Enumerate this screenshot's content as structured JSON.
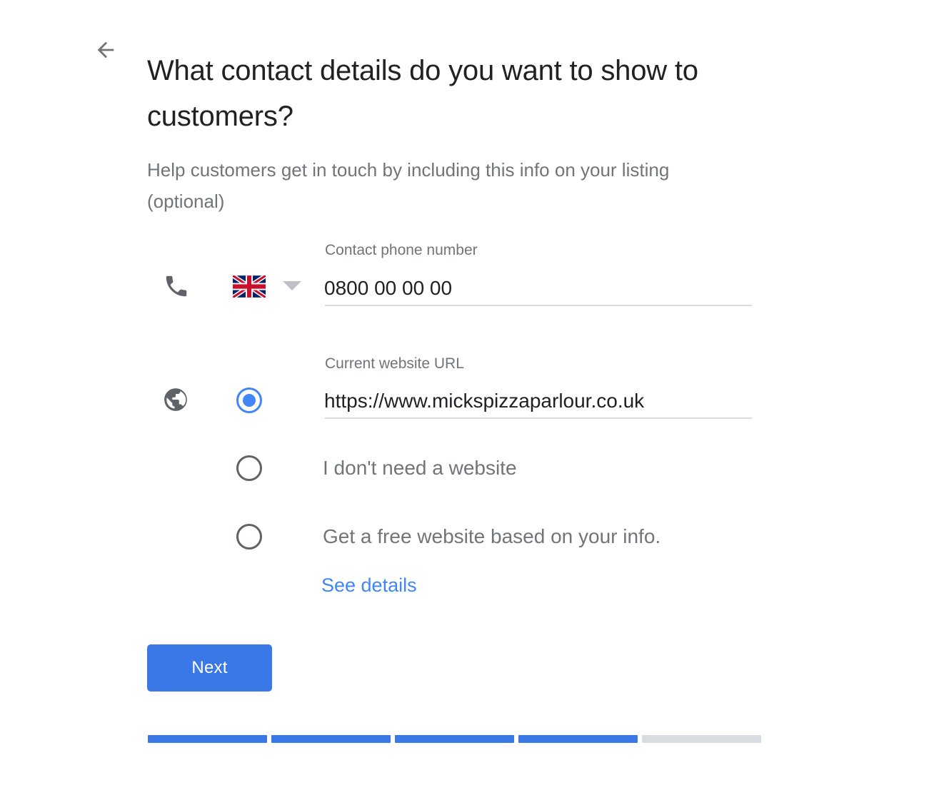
{
  "header": {
    "back_icon": "arrow-left-icon",
    "title": "What contact details do you want to show to customers?",
    "subtitle": "Help customers get in touch by including this info on your listing (optional)"
  },
  "phone": {
    "icon": "phone-icon",
    "country_flag": "uk-flag-icon",
    "country_caret": "chevron-down-icon",
    "label": "Contact phone number",
    "value": "0800 00 00 00",
    "placeholder": "Contact phone number"
  },
  "website": {
    "icon": "globe-icon",
    "label": "Current website URL",
    "value": "https://www.mickspizzaparlour.co.uk",
    "placeholder": "Current website URL",
    "options": [
      {
        "id": "current-url",
        "label": "",
        "selected": true
      },
      {
        "id": "no-website",
        "label": "I don't need a website",
        "selected": false
      },
      {
        "id": "free-website",
        "label": "Get a free website based on your info.",
        "selected": false
      }
    ],
    "see_details_link": "See details"
  },
  "actions": {
    "next_label": "Next"
  },
  "progress": {
    "total_steps": 5,
    "completed_steps": 4,
    "segments": [
      "done",
      "done",
      "done",
      "done",
      "todo"
    ]
  },
  "colors": {
    "accent_blue": "#4285f4",
    "button_blue": "#3b78e7",
    "progress_done": "#3b78e7",
    "progress_todo": "#d9dce0",
    "text_primary": "#202124",
    "text_secondary": "#70757a",
    "underline": "#dadce0"
  }
}
